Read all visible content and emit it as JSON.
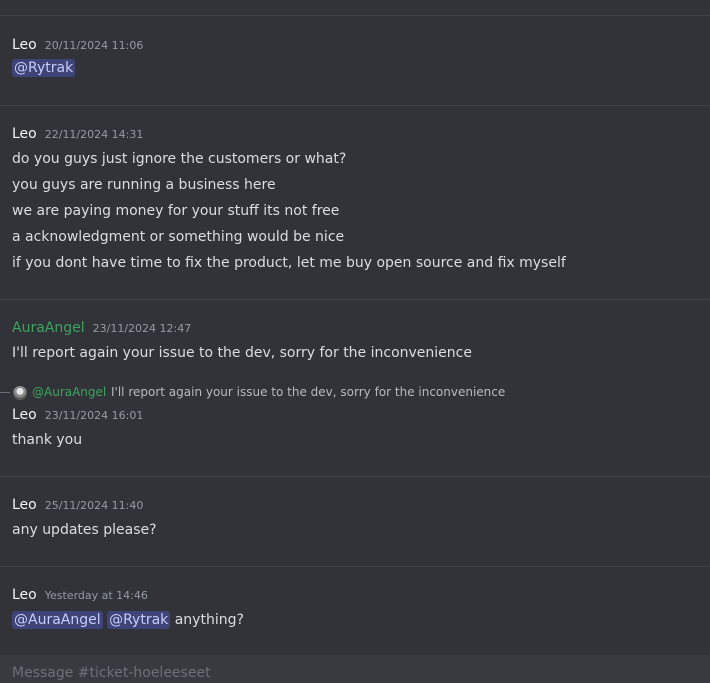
{
  "messages": [
    {
      "author": "Leo",
      "timestamp": "20/11/2024 11:06",
      "mention": "@Rytrak"
    },
    {
      "author": "Leo",
      "timestamp": "22/11/2024 14:31",
      "lines": [
        "do you guys just ignore the customers or what?",
        "you guys are running a business here",
        "we are paying money for your stuff its not free",
        "a acknowledgment or something would be nice",
        "if you dont have time to fix the product, let me buy open source and fix myself"
      ]
    },
    {
      "author": "AuraAngel",
      "author_color": "#3ba55d",
      "timestamp": "23/11/2024 12:47",
      "lines": [
        "I'll report again your issue to the dev, sorry for the inconvenience"
      ]
    },
    {
      "reply_to": {
        "name": "@AuraAngel",
        "text": "I'll report again your issue to the dev, sorry for the inconvenience"
      },
      "author": "Leo",
      "timestamp": "23/11/2024 16:01",
      "lines": [
        "thank you"
      ]
    },
    {
      "author": "Leo",
      "timestamp": "25/11/2024 11:40",
      "lines": [
        "any updates please?"
      ]
    },
    {
      "author": "Leo",
      "timestamp": "Yesterday at 14:46",
      "mentions": [
        "@AuraAngel",
        "@Rytrak"
      ],
      "text_after": "anything?"
    }
  ],
  "composer": {
    "placeholder": "Message #ticket-hoeleeseet"
  },
  "colors": {
    "background": "#313338",
    "mention_bg": "#3c4270",
    "green_name": "#3ba55d"
  }
}
